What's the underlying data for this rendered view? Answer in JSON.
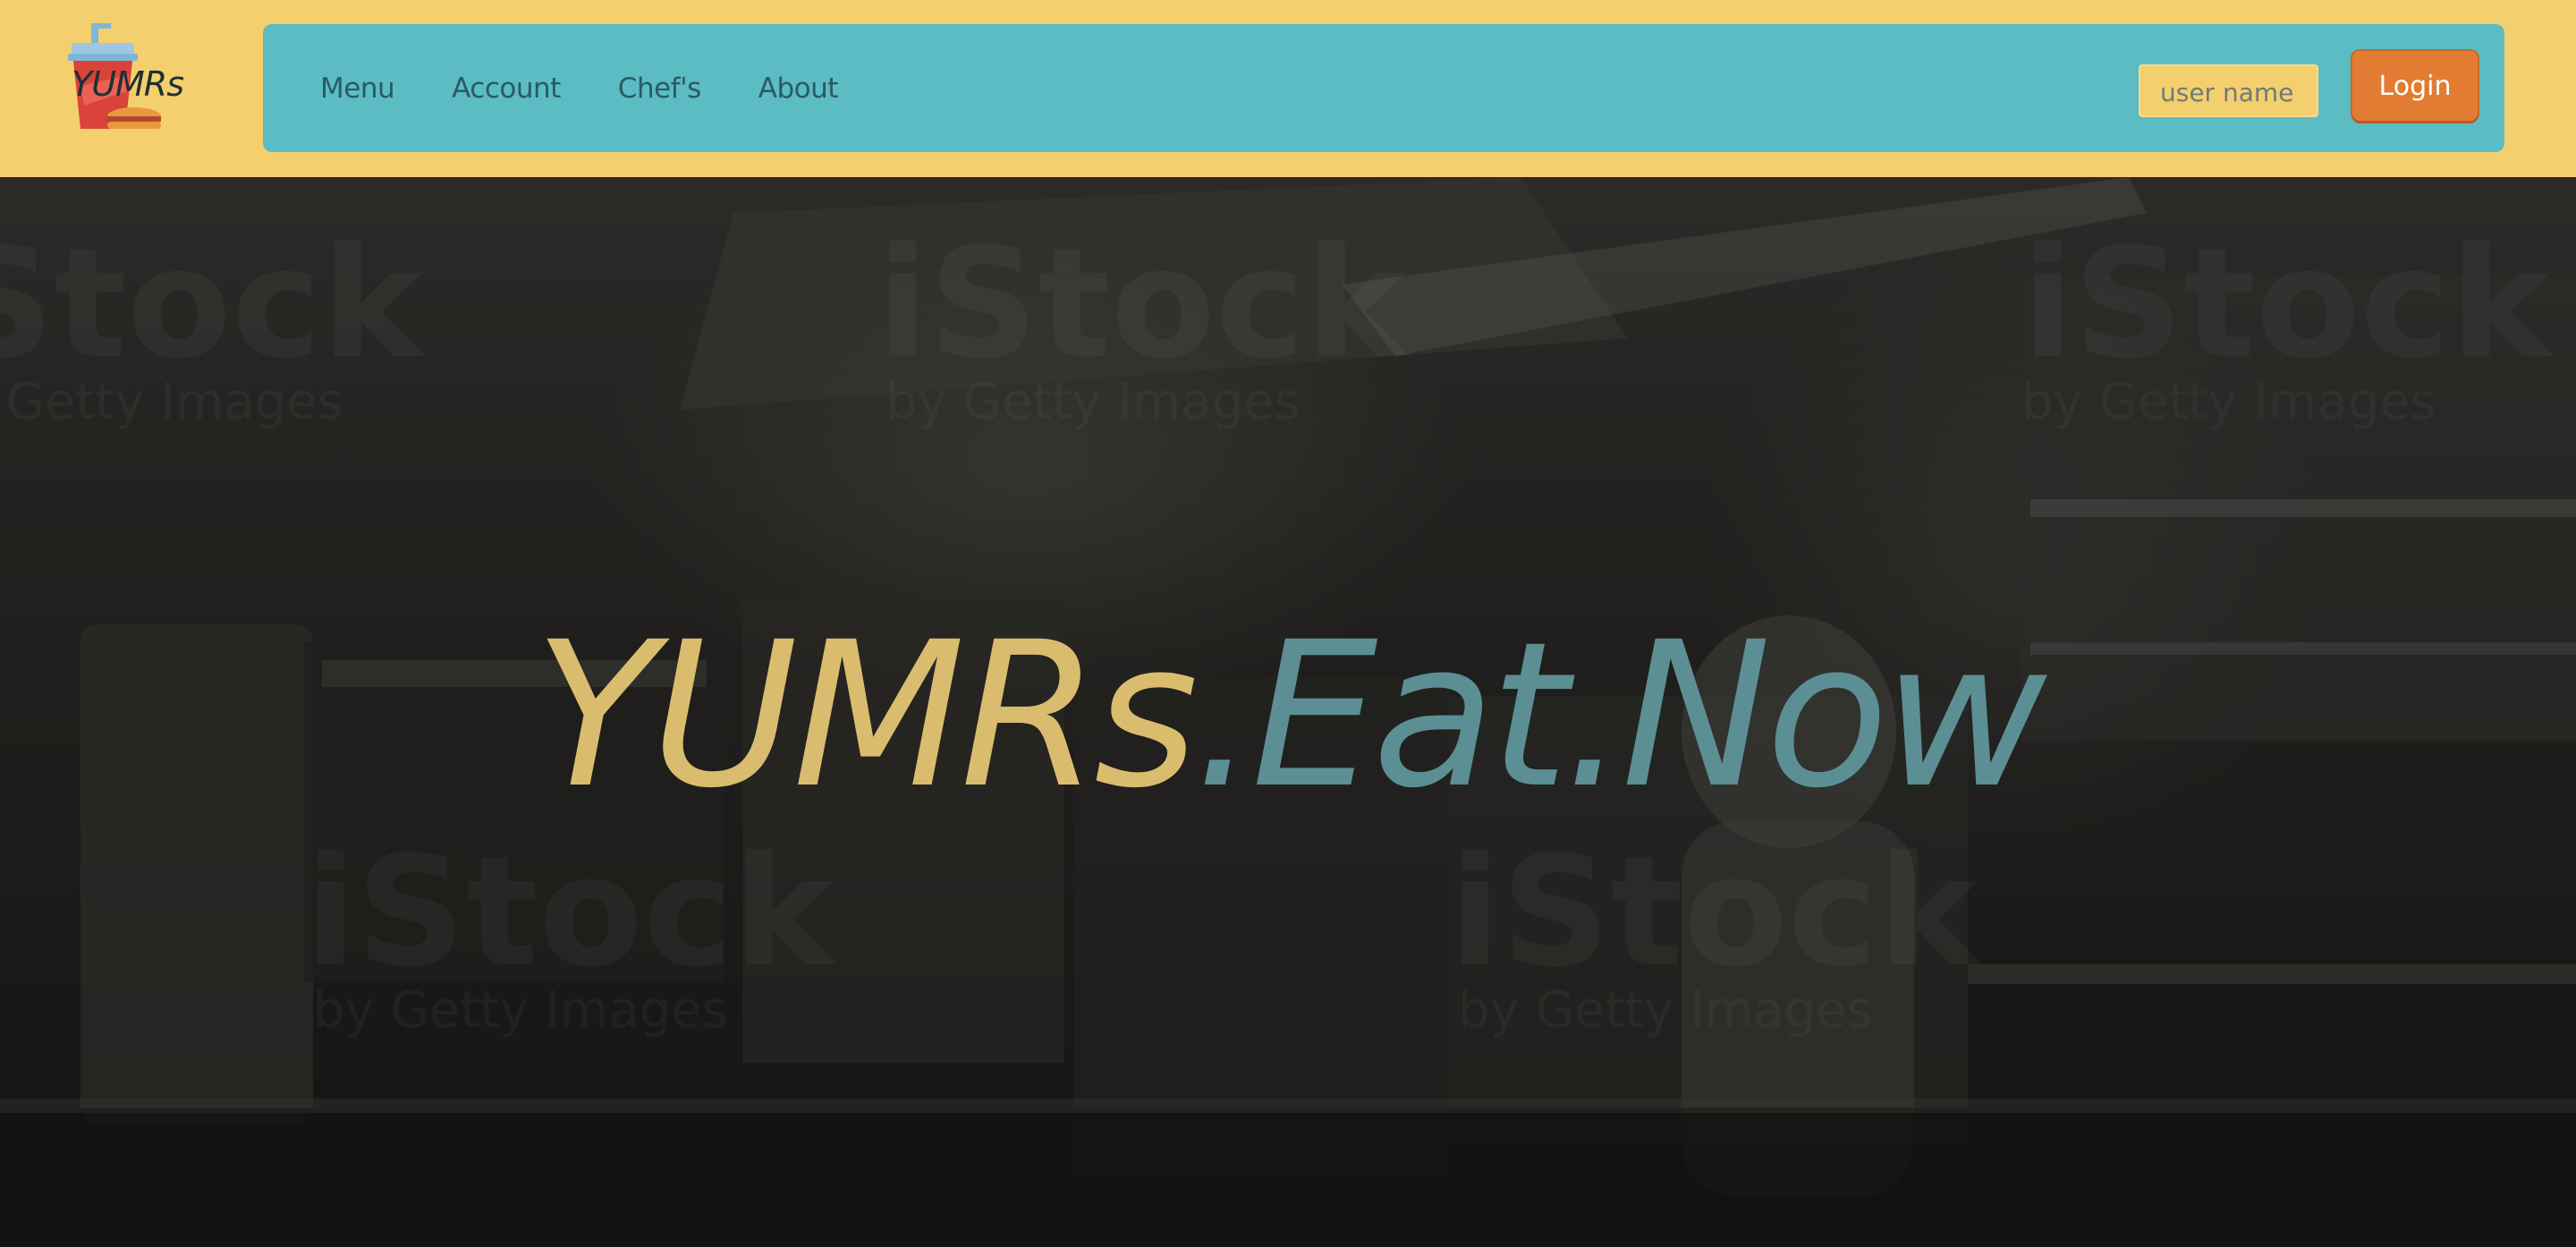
{
  "brand": {
    "logo_text": "YUMRs"
  },
  "nav": {
    "items": [
      {
        "label": "Menu"
      },
      {
        "label": "Account"
      },
      {
        "label": "Chef's"
      },
      {
        "label": "About"
      }
    ]
  },
  "login": {
    "username_placeholder": "user name",
    "button_label": "Login"
  },
  "hero": {
    "title_brand": "YUMRs",
    "title_tail": ".Eat.Now",
    "watermark_main": "iStock",
    "watermark_sub": "by Getty Images"
  },
  "colors": {
    "header_bg": "#f4cf6e",
    "nav_bg": "#5bbcc4",
    "login_button": "#e17c32",
    "title_brand": "#d9bc6e",
    "title_tail": "#5c8f93"
  },
  "icons": {
    "logo": "soda-and-burger-icon"
  }
}
